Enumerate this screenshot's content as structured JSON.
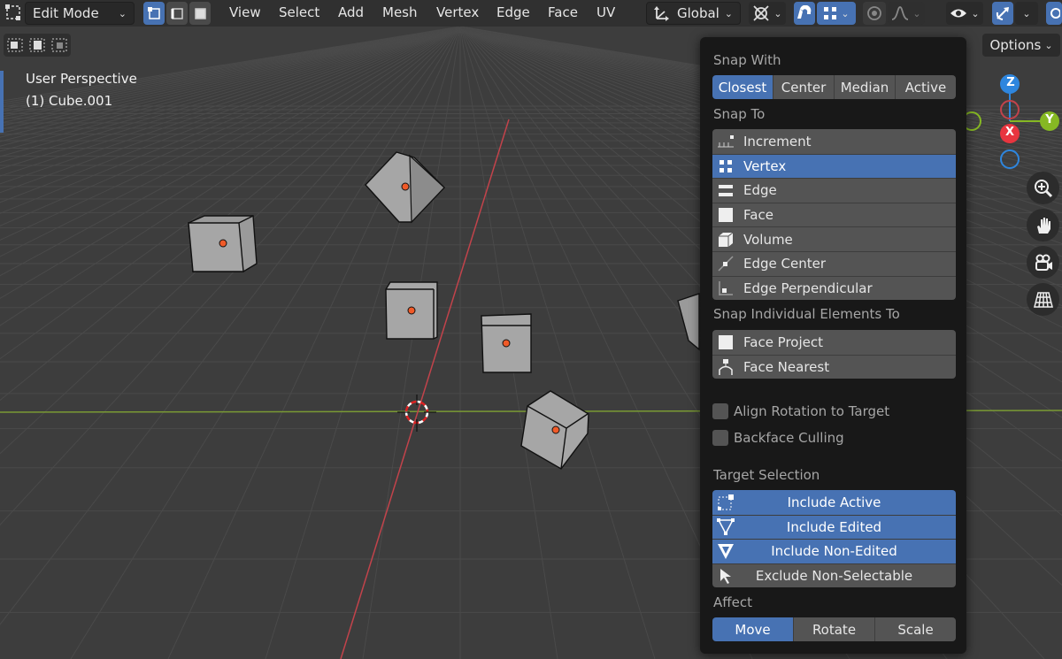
{
  "header": {
    "mode_dropdown": "Edit Mode",
    "menus": [
      "View",
      "Select",
      "Add",
      "Mesh",
      "Vertex",
      "Edge",
      "Face",
      "UV"
    ],
    "orientation": "Global",
    "options_label": "Options"
  },
  "viewport": {
    "perspective_label": "User Perspective",
    "object_label": "(1) Cube.001"
  },
  "gizmo": {
    "z": "Z",
    "y": "Y",
    "x": "X"
  },
  "popup": {
    "snap_with_label": "Snap With",
    "snap_with": [
      "Closest",
      "Center",
      "Median",
      "Active"
    ],
    "snap_with_active": "Closest",
    "snap_to_label": "Snap To",
    "snap_to": [
      {
        "label": "Increment",
        "icon": "increment-icon",
        "active": false
      },
      {
        "label": "Vertex",
        "icon": "vertex-icon",
        "active": true
      },
      {
        "label": "Edge",
        "icon": "edge-icon",
        "active": false
      },
      {
        "label": "Face",
        "icon": "face-icon",
        "active": false
      },
      {
        "label": "Volume",
        "icon": "volume-icon",
        "active": false
      },
      {
        "label": "Edge Center",
        "icon": "edge-center-icon",
        "active": false
      },
      {
        "label": "Edge Perpendicular",
        "icon": "edge-perpendicular-icon",
        "active": false
      }
    ],
    "snap_individual_label": "Snap Individual Elements To",
    "snap_individual": [
      {
        "label": "Face Project",
        "icon": "face-project-icon"
      },
      {
        "label": "Face Nearest",
        "icon": "face-nearest-icon"
      }
    ],
    "align_rotation": "Align Rotation to Target",
    "backface_culling": "Backface Culling",
    "target_selection_label": "Target Selection",
    "target_selection": [
      {
        "label": "Include Active",
        "icon": "include-active-icon",
        "active": true
      },
      {
        "label": "Include Edited",
        "icon": "include-edited-icon",
        "active": true
      },
      {
        "label": "Include Non-Edited",
        "icon": "include-non-edited-icon",
        "active": true
      },
      {
        "label": "Exclude Non-Selectable",
        "icon": "exclude-non-selectable-icon",
        "active": false
      }
    ],
    "affect_label": "Affect",
    "affect": [
      "Move",
      "Rotate",
      "Scale"
    ],
    "affect_active": "Move"
  },
  "colors": {
    "accent": "#4772b3",
    "x_axis": "#e8353f",
    "y_axis": "#86b823",
    "z_axis": "#2e86de",
    "origin_dot": "#f05a28"
  }
}
